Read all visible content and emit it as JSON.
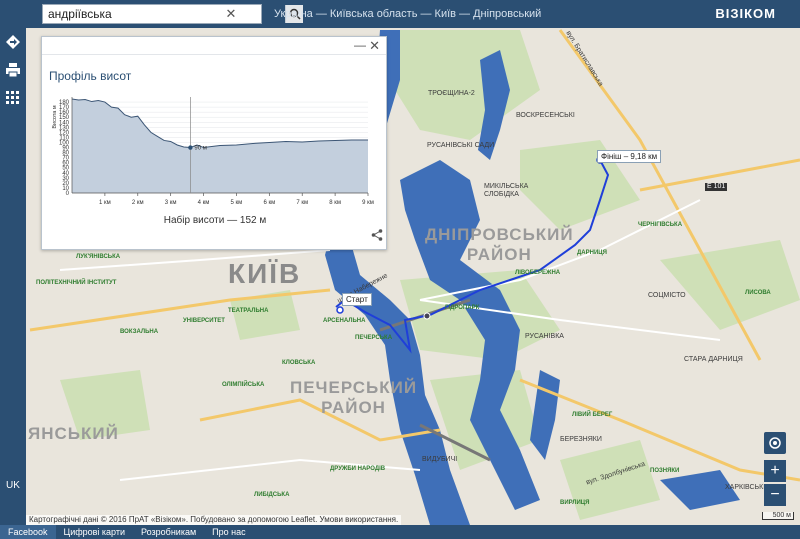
{
  "search": {
    "value": "андріївська"
  },
  "breadcrumb": "Україна — Київська область — Київ — Дніпровський",
  "logo": "ВІЗІКОМ",
  "lang": "UK",
  "profile": {
    "title": "Профіль висот",
    "caption": "Набір висоти — 152 м",
    "marker_label": "90 м"
  },
  "chart_data": {
    "type": "area",
    "ylabel": "Висота м",
    "ylim": [
      0,
      190
    ],
    "yticks": [
      0,
      10,
      20,
      30,
      40,
      50,
      60,
      70,
      80,
      90,
      100,
      110,
      120,
      130,
      140,
      150,
      160,
      170,
      180
    ],
    "xlim": [
      0,
      9
    ],
    "xticks": [
      "1 км",
      "2 км",
      "3 км",
      "4 км",
      "5 км",
      "6 км",
      "7 км",
      "8 км",
      "9 км"
    ],
    "x": [
      0,
      0.2,
      0.4,
      0.6,
      0.8,
      1.0,
      1.2,
      1.4,
      1.6,
      1.8,
      2.0,
      2.2,
      2.4,
      2.6,
      2.8,
      3.0,
      3.2,
      3.4,
      3.6,
      3.8,
      4.0,
      4.5,
      5.0,
      5.5,
      6.0,
      6.5,
      7.0,
      7.5,
      8.0,
      8.5,
      9.0
    ],
    "y": [
      186,
      184,
      185,
      181,
      183,
      180,
      170,
      168,
      155,
      150,
      152,
      135,
      120,
      112,
      104,
      102,
      95,
      91,
      90,
      95,
      90,
      94,
      95,
      98,
      100,
      102,
      101,
      103,
      104,
      105,
      105
    ],
    "marker_x": 3.6
  },
  "map": {
    "city": "КИЇВ",
    "districts": [
      "ДНІПРОВСЬКИЙ\nРАЙОН",
      "ПЕЧЕРСЬКИЙ\nРАЙОН",
      "ЯНСЬКИЙ"
    ],
    "finish": "Фініш – 9,18 км",
    "start": "Старт",
    "labels": [
      "ДНІПРОВСЬКИЙ",
      "ВОСКРЕСЕНСЬКІ",
      "РУСАНІВСЬКІ САДИ",
      "ТРОЄЩИНА-2",
      "МИКІЛЬСЬКА СЛОБІДКА",
      "ДАРНИЦЯ",
      "ЧЕРНІГІВСЬКА",
      "ГІДРОПАРК",
      "ЛІВОБЕРЕЖНА",
      "РУСАНІВКА",
      "СОЦМІСТО",
      "СТАРА ДАРНИЦЯ",
      "БЕРЕЗНЯКИ",
      "ДРУЖБИ НАРОДІВ",
      "ЛИБІДСЬКА",
      "ВИДУБИЧІ",
      "АРСЕНАЛЬНА",
      "ЛУК'ЯНІВСЬКА",
      "УНІВЕРСИТЕТ",
      "ТЕАТРАЛЬНА",
      "КЛОВСЬКА",
      "ОЛІМПІЙСЬКА",
      "ПЕЧЕРСЬКА",
      "ВОКЗАЛЬНА",
      "ПОЛІТЕХНІЧНИЙ ІНСТИТУТ",
      "ЛИСОВА",
      "ХАРКІВСЬКІ",
      "ЛІВИЙ БЕРЕГ",
      "ПОЗНЯКИ",
      "ВИРЛИЦЯ"
    ],
    "street_labels": [
      "вул. Братиславська",
      "вул. Здолбунівська",
      "шосе Набережне",
      "Е 101"
    ]
  },
  "attribution": "Картографічні дані © 2016 ПрАТ «Візіком». Побудовано за допомогою Leaflet. Умови використання.",
  "scale": "500 м",
  "footer": [
    "Facebook",
    "Цифрові карти",
    "Розробникам",
    "Про нас"
  ],
  "colors": {
    "bar": "#2b4f73",
    "route": "#1f3fd9",
    "water": "#3f6fb8",
    "park": "#cfe0b7"
  }
}
